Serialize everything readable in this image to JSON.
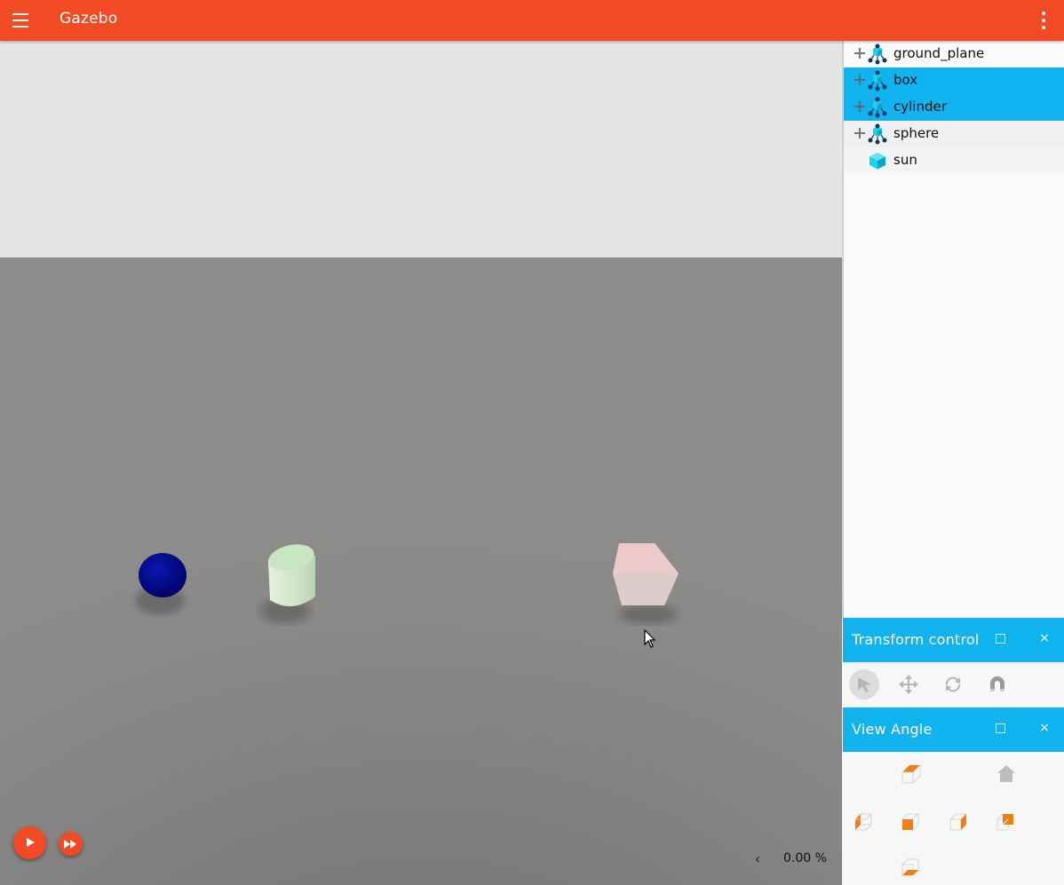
{
  "header": {
    "title": "Gazebo",
    "menu_icon": "hamburger-menu-icon",
    "overflow_icon": "more-vert-icon"
  },
  "colors": {
    "accent": "#f14a24",
    "selection": "#11b3ef",
    "sky": "#e6e5e3",
    "ground": "#82807e",
    "sphere": "#00008b",
    "cylinder": "#d4e9cf",
    "box": "#e8d4d4",
    "view_icon_orange": "#f07e15"
  },
  "entity_tree": {
    "items": [
      {
        "label": "ground_plane",
        "icon": "model-icon",
        "expandable": true,
        "selected": false
      },
      {
        "label": "box",
        "icon": "model-icon",
        "expandable": true,
        "selected": true
      },
      {
        "label": "cylinder",
        "icon": "model-icon",
        "expandable": true,
        "selected": true
      },
      {
        "label": "sphere",
        "icon": "model-icon",
        "expandable": true,
        "selected": false
      },
      {
        "label": "sun",
        "icon": "light-icon",
        "expandable": false,
        "selected": false
      }
    ]
  },
  "transform_control": {
    "title": "Transform control",
    "tools": [
      "select-icon",
      "translate-icon",
      "rotate-icon",
      "snap-magnet-icon"
    ],
    "active_tool": "select-icon"
  },
  "view_angle": {
    "title": "View Angle",
    "buttons": [
      "view-top-icon",
      "view-home-icon",
      "view-left-icon",
      "view-front-icon",
      "view-right-icon",
      "view-back-icon",
      "view-bottom-icon"
    ]
  },
  "playback": {
    "play_icon": "play-icon",
    "step_icon": "fast-forward-icon",
    "rtf_toggle": "‹",
    "real_time_factor": "0.00 %"
  },
  "panel_controls": {
    "maximize_icon": "maximize-icon",
    "close_glyph": "×"
  }
}
